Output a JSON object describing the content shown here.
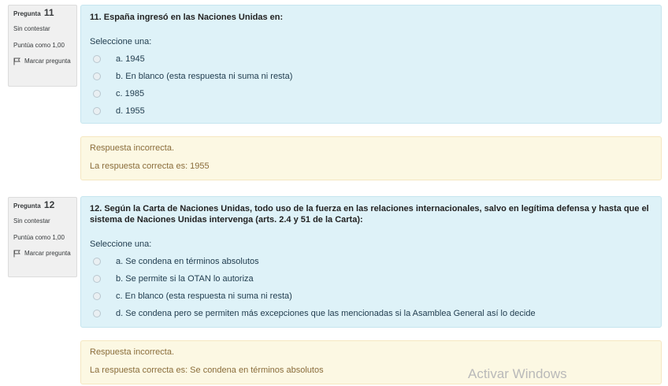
{
  "questions": [
    {
      "label": "Pregunta",
      "number": "11",
      "state": "Sin contestar",
      "grade": "Puntúa como 1,00",
      "flag_label": "Marcar pregunta",
      "text": "11. España ingresó en las Naciones Unidas en:",
      "prompt": "Seleccione una:",
      "answers": [
        "a. 1945",
        "b. En blanco (esta respuesta ni suma ni resta)",
        "c. 1985",
        "d. 1955"
      ],
      "feedback_status": "Respuesta incorrecta.",
      "feedback_right": "La respuesta correcta es: 1955"
    },
    {
      "label": "Pregunta",
      "number": "12",
      "state": "Sin contestar",
      "grade": "Puntúa como 1,00",
      "flag_label": "Marcar pregunta",
      "text": "12. Según la Carta de Naciones Unidas, todo uso de la fuerza en las relaciones internacionales, salvo en legítima defensa y hasta que el sistema de Naciones Unidas intervenga (arts. 2.4 y 51 de la Carta):",
      "prompt": "Seleccione una:",
      "answers": [
        "a. Se condena en términos absolutos",
        "b. Se permite si la OTAN lo autoriza",
        "c. En blanco (esta respuesta ni suma ni resta)",
        "d. Se condena pero se permiten más excepciones que las mencionadas si la Asamblea General así lo decide"
      ],
      "feedback_status": "Respuesta incorrecta.",
      "feedback_right": "La respuesta correcta es: Se condena en términos absolutos"
    }
  ],
  "watermark": "Activar Windows",
  "icons": {
    "flag": "flag-icon",
    "radio": "radio-unchecked-icon"
  },
  "colors": {
    "question_bg": "#def2f8",
    "feedback_bg": "#fcf8e3",
    "feedback_text": "#8a6d3b",
    "info_bg": "#f0f0f0"
  }
}
